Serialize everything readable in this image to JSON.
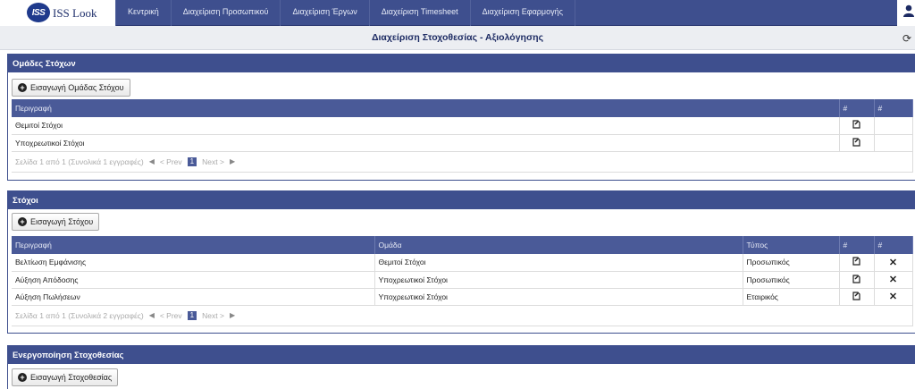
{
  "app": {
    "logo_badge": "ISS",
    "logo_text": "ISS Look",
    "nav": [
      "Κεντρική",
      "Διαχείριση Προσωπικού",
      "Διαχείριση Έργων",
      "Διαχείριση Timesheet",
      "Διαχείριση Εφαρμογής"
    ],
    "page_title": "Διαχείριση Στοχοθεσίας - Αξιολόγησης"
  },
  "groups": {
    "title": "Ομάδες Στόχων",
    "add_label": "Εισαγωγή Ομάδας Στόχου",
    "columns": [
      "Περιγραφή",
      "#",
      "#"
    ],
    "rows": [
      {
        "description": "Θεμιτοί Στόχοι"
      },
      {
        "description": "Υποχρεωτικοί Στόχοι"
      }
    ],
    "pager": {
      "summary": "Σελίδα 1 από 1 (Συνολικά 1 εγγραφές)",
      "prev": "< Prev",
      "page": "1",
      "next": "Next >"
    }
  },
  "goals": {
    "title": "Στόχοι",
    "add_label": "Εισαγωγή Στόχου",
    "columns": [
      "Περιγραφή",
      "Ομάδα",
      "Τύπος",
      "#",
      "#"
    ],
    "rows": [
      {
        "description": "Βελτίωση Εμφάνισης",
        "group": "Θεμιτοί Στόχοι",
        "type": "Προσωπικός"
      },
      {
        "description": "Αύξηση Απόδοσης",
        "group": "Υποχρεωτικοί Στόχοι",
        "type": "Προσωπικός"
      },
      {
        "description": "Αύξηση Πωλήσεων",
        "group": "Υποχρεωτικοί Στόχοι",
        "type": "Εταιρικός"
      }
    ],
    "pager": {
      "summary": "Σελίδα 1 από 1 (Συνολικά 2 εγγραφές)",
      "prev": "< Prev",
      "page": "1",
      "next": "Next >"
    }
  },
  "activation": {
    "title": "Ενεργοποίηση Στοχοθεσίας",
    "add_label": "Εισαγωγή Στοχοθεσίας"
  },
  "colors": {
    "accent": "#3e4f8e",
    "header_row": "#4a5a98"
  }
}
